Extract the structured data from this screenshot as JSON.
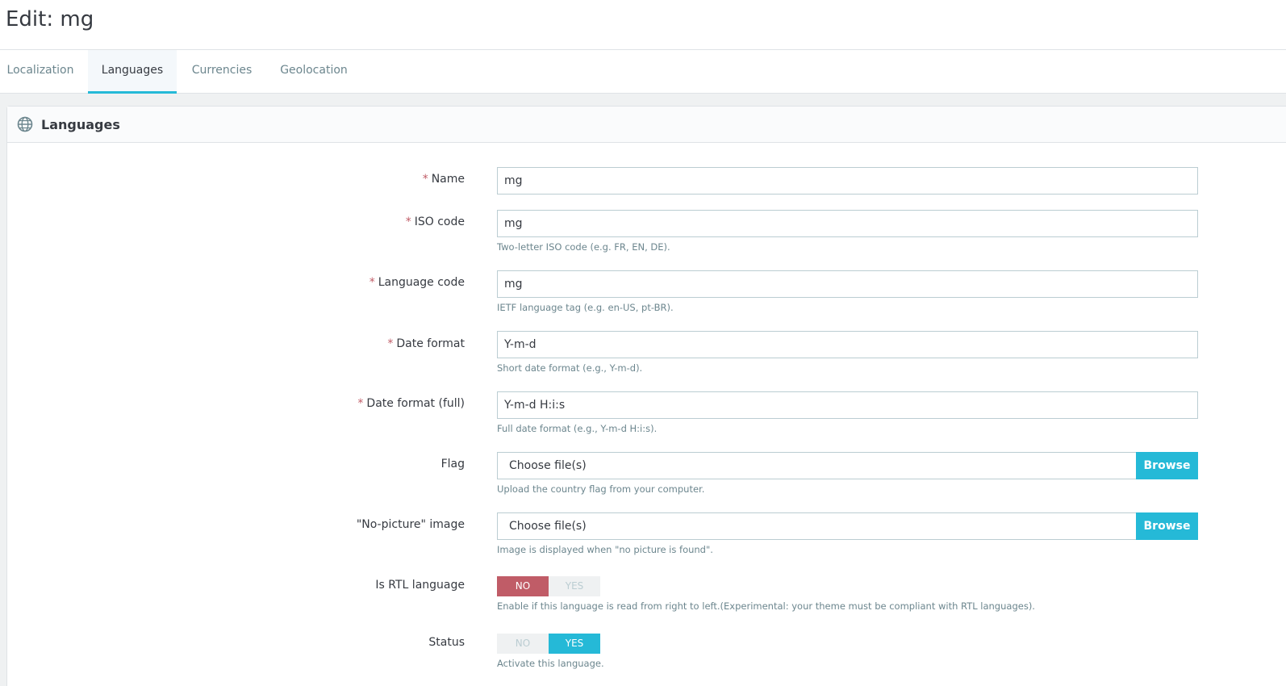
{
  "page": {
    "title": "Edit: mg"
  },
  "tabs": [
    {
      "label": "Localization"
    },
    {
      "label": "Languages"
    },
    {
      "label": "Currencies"
    },
    {
      "label": "Geolocation"
    }
  ],
  "panel": {
    "title": "Languages",
    "icon": "globe-icon"
  },
  "form": {
    "required_mark": "*",
    "name": {
      "label": "Name",
      "value": "mg"
    },
    "iso_code": {
      "label": "ISO code",
      "value": "mg",
      "help": "Two-letter ISO code (e.g. FR, EN, DE)."
    },
    "language_code": {
      "label": "Language code",
      "value": "mg",
      "help": "IETF language tag (e.g. en-US, pt-BR)."
    },
    "date_format": {
      "label": "Date format",
      "value": "Y-m-d",
      "help": "Short date format (e.g., Y-m-d)."
    },
    "date_format_full": {
      "label": "Date format (full)",
      "value": "Y-m-d H:i:s",
      "help": "Full date format (e.g., Y-m-d H:i:s)."
    },
    "flag": {
      "label": "Flag",
      "placeholder": "Choose file(s)",
      "button": "Browse",
      "help": "Upload the country flag from your computer."
    },
    "no_picture": {
      "label": "\"No-picture\" image",
      "placeholder": "Choose file(s)",
      "button": "Browse",
      "help": "Image is displayed when \"no picture is found\"."
    },
    "is_rtl": {
      "label": "Is RTL language",
      "no": "NO",
      "yes": "YES",
      "selected": "NO",
      "help": "Enable if this language is read from right to left.(Experimental: your theme must be compliant with RTL languages)."
    },
    "status": {
      "label": "Status",
      "no": "NO",
      "yes": "YES",
      "selected": "YES",
      "help": "Activate this language."
    }
  },
  "colors": {
    "accent": "#25b9d7",
    "danger": "#c05c67",
    "required": "#c05c67"
  }
}
